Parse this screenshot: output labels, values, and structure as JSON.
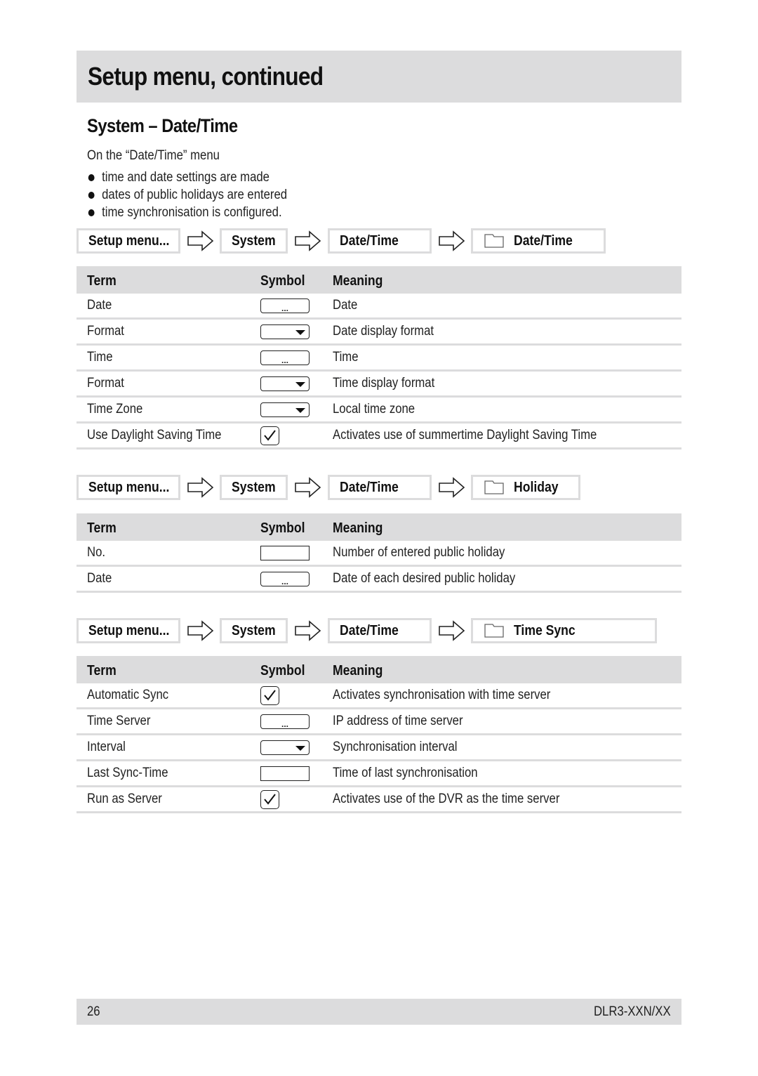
{
  "header": {
    "title": "Setup menu, continued"
  },
  "section": {
    "title": "System – Date/Time",
    "intro": "On the “Date/Time” menu",
    "bullets": [
      "time and date settings are made",
      "dates of public holidays are entered",
      "time synchronisation is configured."
    ]
  },
  "table_headers": {
    "term": "Term",
    "symbol": "Symbol",
    "meaning": "Meaning"
  },
  "paths": [
    {
      "crumbs": [
        "Setup menu...",
        "System",
        "Date/Time"
      ],
      "target": "Date/Time",
      "target_icon": "folder-icon"
    },
    {
      "crumbs": [
        "Setup menu...",
        "System",
        "Date/Time"
      ],
      "target": "Holiday",
      "target_icon": "folder-icon"
    },
    {
      "crumbs": [
        "Setup menu...",
        "System",
        "Date/Time"
      ],
      "target": "Time Sync",
      "target_icon": "folder-icon"
    }
  ],
  "tables": [
    {
      "rows": [
        {
          "term": "Date",
          "symbol": "input-ellipsis",
          "meaning": "Date"
        },
        {
          "term": "Format",
          "symbol": "dropdown",
          "meaning": "Date display format"
        },
        {
          "term": "Time",
          "symbol": "input-ellipsis",
          "meaning": "Time"
        },
        {
          "term": "Format",
          "symbol": "dropdown",
          "meaning": "Time display format"
        },
        {
          "term": "Time Zone",
          "symbol": "dropdown",
          "meaning": "Local time zone"
        },
        {
          "term": "Use Daylight Saving Time",
          "symbol": "checkbox",
          "meaning": "Activates use of summertime Daylight Saving Time"
        }
      ]
    },
    {
      "rows": [
        {
          "term": "No.",
          "symbol": "text-field",
          "meaning": "Number of entered public holiday"
        },
        {
          "term": "Date",
          "symbol": "input-ellipsis",
          "meaning": "Date of each desired public holiday"
        }
      ]
    },
    {
      "rows": [
        {
          "term": "Automatic Sync",
          "symbol": "checkbox",
          "meaning": "Activates synchronisation with time server"
        },
        {
          "term": "Time Server",
          "symbol": "input-ellipsis",
          "meaning": "IP address of time server"
        },
        {
          "term": "Interval",
          "symbol": "dropdown",
          "meaning": "Synchronisation interval"
        },
        {
          "term": "Last Sync-Time",
          "symbol": "text-field",
          "meaning": "Time of last synchronisation"
        },
        {
          "term": "Run as Server",
          "symbol": "checkbox",
          "meaning": "Activates use of the DVR as the time server"
        }
      ]
    }
  ],
  "symbol_glyphs": {
    "ellipsis": "..."
  },
  "footer": {
    "page_number": "26",
    "model": "DLR3-XXN/XX"
  }
}
